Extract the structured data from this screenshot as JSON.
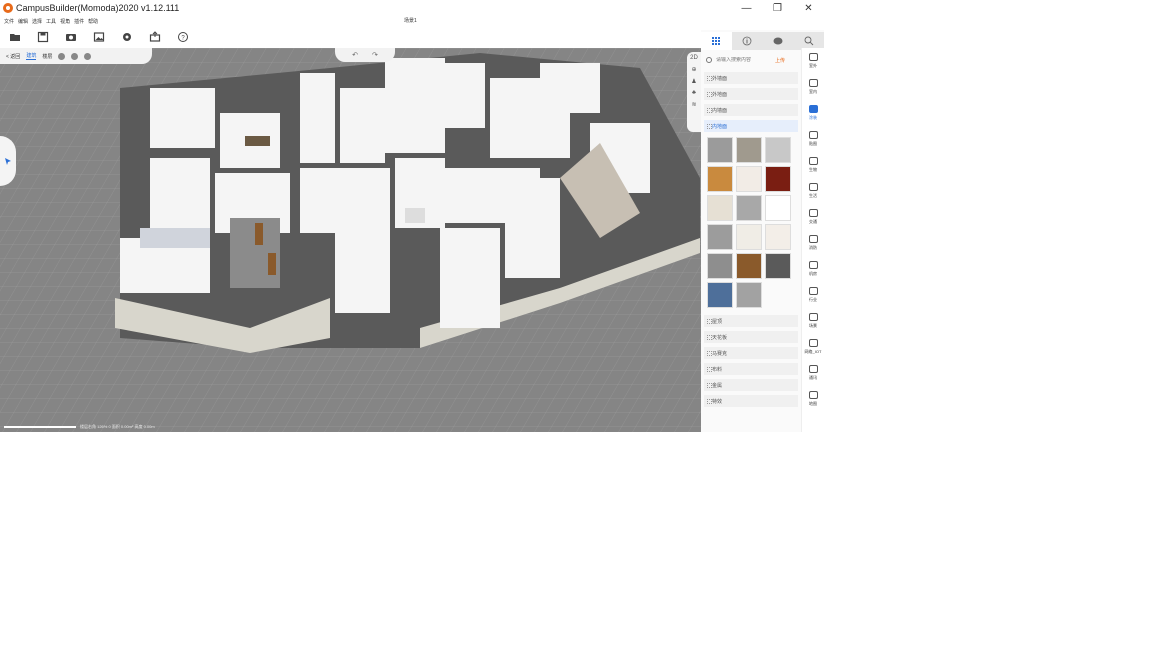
{
  "window": {
    "title": "CampusBuilder(Momoda)2020 v1.12.111",
    "minimize": "—",
    "restore": "❐",
    "close": "✕"
  },
  "menu": [
    "文件",
    "编辑",
    "选择",
    "工具",
    "视角",
    "插件",
    "帮助"
  ],
  "scene_name": "场景1",
  "toolbar": {
    "icons": [
      "folder-open-icon",
      "save-icon",
      "camera-icon",
      "image-icon",
      "gear-icon",
      "export-icon",
      "help-icon"
    ]
  },
  "viewport": {
    "back_label": "< 返回",
    "tab_building": "建筑",
    "tab_floor": "楼层",
    "undo": "↶",
    "redo": "↷",
    "mode_2d": "2D",
    "status": "楼层右角 126% 0  面积 0.00m²  高度 0.00m"
  },
  "panel": {
    "tabs": [
      "grid-icon",
      "info-icon",
      "palette-icon",
      "search-icon"
    ],
    "search_placeholder": "请输入搜索内容",
    "upload_label": "上传",
    "categories_top": [
      {
        "label": "外墙面",
        "active": false
      },
      {
        "label": "外地面",
        "active": false
      },
      {
        "label": "内墙面",
        "active": false
      },
      {
        "label": "内地面",
        "active": true
      }
    ],
    "swatch_colors": [
      "#9b9b9b",
      "#a09a8e",
      "#c8c8c8",
      "#c98a3e",
      "#f2ece6",
      "#7a1e12",
      "#e6e0d4",
      "#a8a8a8",
      "#ffffff",
      "#9c9c9c",
      "#f0ede6",
      "#f3eee8",
      "#8e8e8e",
      "#8a5a2b",
      "#5a5a5a",
      "#4e6f9a",
      "#a2a2a2"
    ],
    "categories_bottom": [
      "屋顶",
      "天花板",
      "马赛克",
      "布料",
      "金属",
      "特效"
    ]
  },
  "sidenav": [
    {
      "label": "室外",
      "icon": "building-icon",
      "active": false
    },
    {
      "label": "室内",
      "icon": "house-icon",
      "active": false
    },
    {
      "label": "涂装",
      "icon": "paint-icon",
      "active": true
    },
    {
      "label": "贴图",
      "icon": "decal-icon",
      "active": false
    },
    {
      "label": "生物",
      "icon": "creature-icon",
      "active": false
    },
    {
      "label": "生活",
      "icon": "life-icon",
      "active": false
    },
    {
      "label": "交通",
      "icon": "car-icon",
      "active": false
    },
    {
      "label": "消防",
      "icon": "fire-icon",
      "active": false
    },
    {
      "label": "机房",
      "icon": "server-icon",
      "active": false
    },
    {
      "label": "行业",
      "icon": "more-icon",
      "active": false
    },
    {
      "label": "场景",
      "icon": "cube-icon",
      "active": false
    },
    {
      "label": "网络_IOT",
      "icon": "list-icon",
      "active": false
    },
    {
      "label": "通讯",
      "icon": "trash-icon",
      "active": false
    },
    {
      "label": "地图",
      "icon": "map-icon",
      "active": false
    }
  ]
}
